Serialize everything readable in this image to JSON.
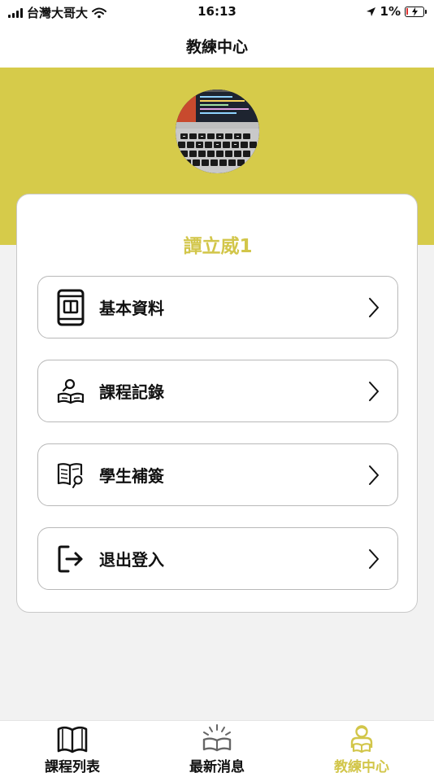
{
  "status": {
    "carrier": "台灣大哥大",
    "time": "16:13",
    "battery": "1%"
  },
  "header": {
    "title": "教練中心"
  },
  "profile": {
    "name": "譚立威1",
    "avatar_icon": "laptop-keyboard-photo"
  },
  "menu": [
    {
      "label": "基本資料",
      "icon": "id-card-icon"
    },
    {
      "label": "課程記錄",
      "icon": "book-search-icon"
    },
    {
      "label": "學生補簽",
      "icon": "book-pen-icon"
    },
    {
      "label": "退出登入",
      "icon": "logout-icon"
    }
  ],
  "tabs": [
    {
      "label": "課程列表",
      "icon": "open-book-icon",
      "active": false
    },
    {
      "label": "最新消息",
      "icon": "news-book-icon",
      "active": false
    },
    {
      "label": "教練中心",
      "icon": "coach-icon",
      "active": true
    }
  ],
  "colors": {
    "accent": "#d6cb4a",
    "accent_text": "#d2c64a",
    "background": "#f2f2f2"
  }
}
